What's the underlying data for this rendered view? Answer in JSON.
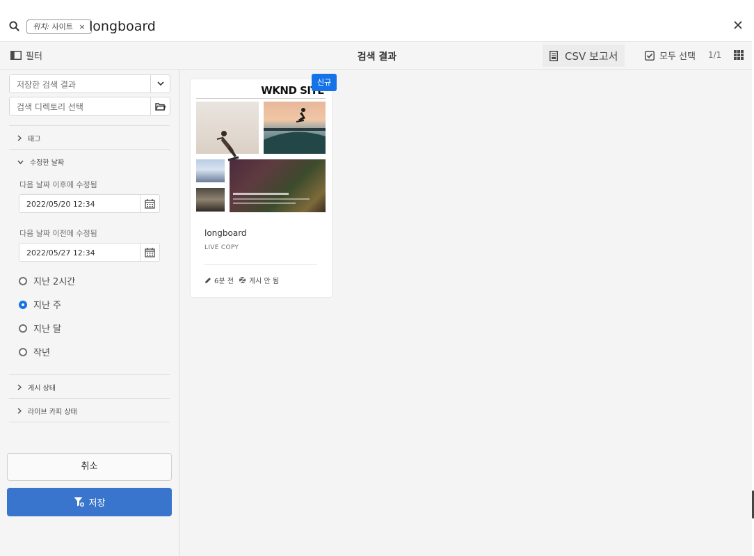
{
  "search": {
    "location_tag_label": "위치:",
    "location_tag_value": "사이트",
    "tag_remove": "×",
    "query": "longboard"
  },
  "actionbar": {
    "filter_label": "필터",
    "results_title": "검색 결과",
    "csv_label": "CSV 보고서",
    "select_all_label": "모두 선택",
    "page_count": "1/1"
  },
  "sidebar": {
    "saved_search_placeholder": "저장한 검색 결과",
    "directory_placeholder": "검색 디렉토리 선택",
    "tags_label": "태그",
    "modified_date_label": "수정한 날짜",
    "modified_after_label": "다음 날짜 이후에 수정됨",
    "modified_after_value": "2022/05/20 12:34",
    "modified_before_label": "다음 날짜 이전에 수정됨",
    "modified_before_value": "2022/05/27 12:34",
    "radios": [
      {
        "label": "지난 2시간",
        "selected": false
      },
      {
        "label": "지난 주",
        "selected": true
      },
      {
        "label": "지난 달",
        "selected": false
      },
      {
        "label": "작년",
        "selected": false
      }
    ],
    "publish_status_label": "게시 상태",
    "live_copy_status_label": "라이브 카피 상태",
    "cancel_label": "취소",
    "save_label": "저장"
  },
  "card": {
    "badge": "신규",
    "brand": "WKND SITE",
    "title": "longboard",
    "subtitle": "LIVE COPY",
    "modified": "6분 전",
    "publish_state": "게시 안 됨"
  },
  "colors": {
    "accent": "#1473e6",
    "save_button": "#3975cc"
  }
}
